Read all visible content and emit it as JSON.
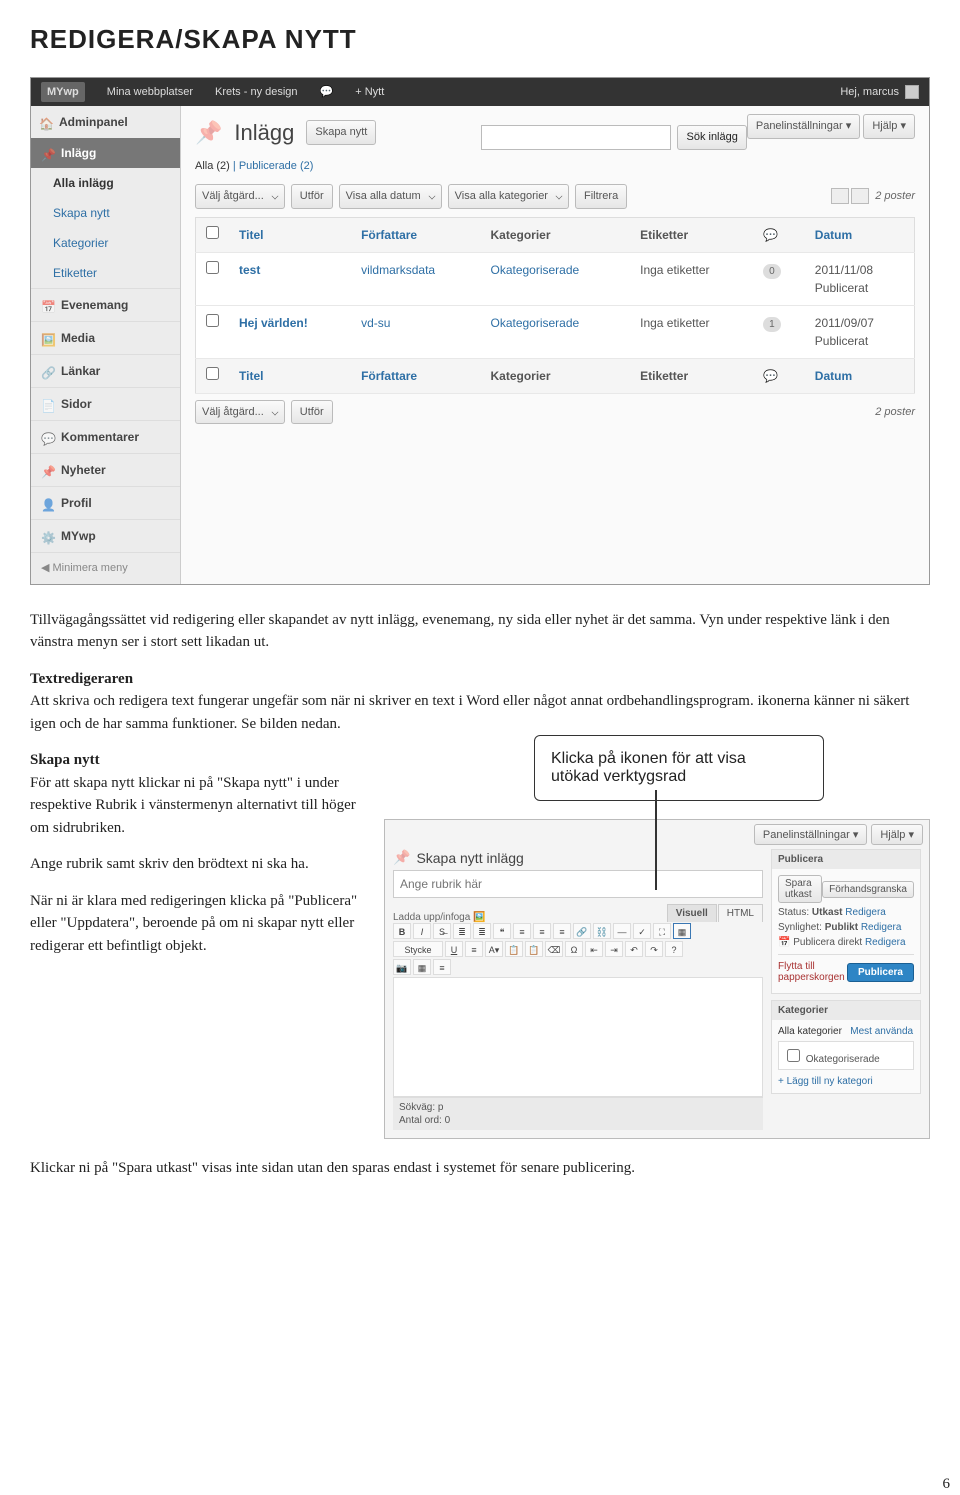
{
  "page": {
    "title": "REDIGERA/SKAPA NYTT",
    "number": "6"
  },
  "adminbar": {
    "brand": "MYwp",
    "items": [
      "Mina webbplatser",
      "Krets - ny design"
    ],
    "add": "+  Nytt",
    "greeting": "Hej, marcus"
  },
  "topright": {
    "panel": "Panelinställningar",
    "help": "Hjälp"
  },
  "sidebar": {
    "dash": "Adminpanel",
    "posts_section": "Inlägg",
    "posts_items": [
      "Alla inlägg",
      "Skapa nytt",
      "Kategorier",
      "Etiketter"
    ],
    "blocks": [
      "Evenemang",
      "Media",
      "Länkar",
      "Sidor",
      "Kommentarer",
      "Nyheter",
      "Profil",
      "MYwp"
    ],
    "minimize": "Minimera meny"
  },
  "mainhead": {
    "title": "Inlägg",
    "addnew": "Skapa nytt"
  },
  "filters": {
    "all": "Alla (2)",
    "sep": " | ",
    "pub": "Publicerade (2)"
  },
  "search": {
    "placeholder": "",
    "button": "Sök inlägg"
  },
  "toolbar": {
    "bulk": "Välj åtgärd...",
    "apply": "Utför",
    "date": "Visa alla datum",
    "cat": "Visa alla kategorier",
    "filter": "Filtrera",
    "postcount": "2 poster"
  },
  "table": {
    "headers": {
      "title": "Titel",
      "author": "Författare",
      "cats": "Kategorier",
      "tags": "Etiketter",
      "date": "Datum"
    },
    "rows": [
      {
        "title": "test",
        "author": "vildmarksdata",
        "cat": "Okategoriserade",
        "tags": "Inga etiketter",
        "comments": "0",
        "date": "2011/11/08",
        "status": "Publicerat"
      },
      {
        "title": "Hej världen!",
        "author": "vd-su",
        "cat": "Okategoriserade",
        "tags": "Inga etiketter",
        "comments": "1",
        "date": "2011/09/07",
        "status": "Publicerat"
      }
    ],
    "bottom_posts": "2 poster"
  },
  "body_text": {
    "p1": "Tillvägagångssättet vid redigering eller skapandet av nytt inlägg, evenemang, ny sida eller nyhet är det samma. Vyn under respektive länk i den vänstra menyn ser i stort sett likadan ut.",
    "h_textred": "Textredigeraren",
    "p2": "Att skriva och redigera text fungerar ungefär som när ni skriver en text i Word eller något annat ordbehandlingsprogram. ikonerna känner ni säkert igen och de har samma funktioner. Se bilden nedan.",
    "h_skapa": "Skapa nytt",
    "p3": "För att skapa nytt klickar ni på \"Skapa nytt\" i under respektive Rubrik i vänstermenyn alternativt till höger om sidrubriken.",
    "p4": "Ange rubrik samt skriv den brödtext ni ska ha.",
    "p5": "När ni är klara med redigeringen klicka på \"Publicera\" eller \"Uppdatera\", beroende på om ni skapar nytt eller redigerar ett befintligt objekt.",
    "p6": "Klickar ni på \"Spara utkast\" visas inte sidan utan den sparas endast i systemet för senare publicering."
  },
  "callout": {
    "l1": "Klicka på ikonen för att visa",
    "l2": "utökad verktygsrad"
  },
  "shot2": {
    "panel": "Panelinställningar",
    "help": "Hjälp",
    "heading": "Skapa nytt inlägg",
    "title_ph": "Ange rubrik här",
    "upload": "Ladda upp/infoga",
    "tab_visual": "Visuell",
    "tab_html": "HTML",
    "style": "Stycke",
    "path": "Sökväg: p",
    "wordcount": "Antal ord: 0",
    "publish_box": {
      "title": "Publicera",
      "save": "Spara utkast",
      "preview": "Förhandsgranska",
      "status_lbl": "Status:",
      "status_val": "Utkast",
      "status_edit": "Redigera",
      "vis_lbl": "Synlighet:",
      "vis_val": "Publikt",
      "vis_edit": "Redigera",
      "sched_lbl": "Publicera direkt",
      "sched_edit": "Redigera",
      "trash": "Flytta till papperskorgen",
      "publish": "Publicera"
    },
    "cat_box": {
      "title": "Kategorier",
      "tab_all": "Alla kategorier",
      "tab_most": "Mest använda",
      "cat_item": "Okategoriserade",
      "add": "+ Lägg till ny kategori"
    }
  }
}
